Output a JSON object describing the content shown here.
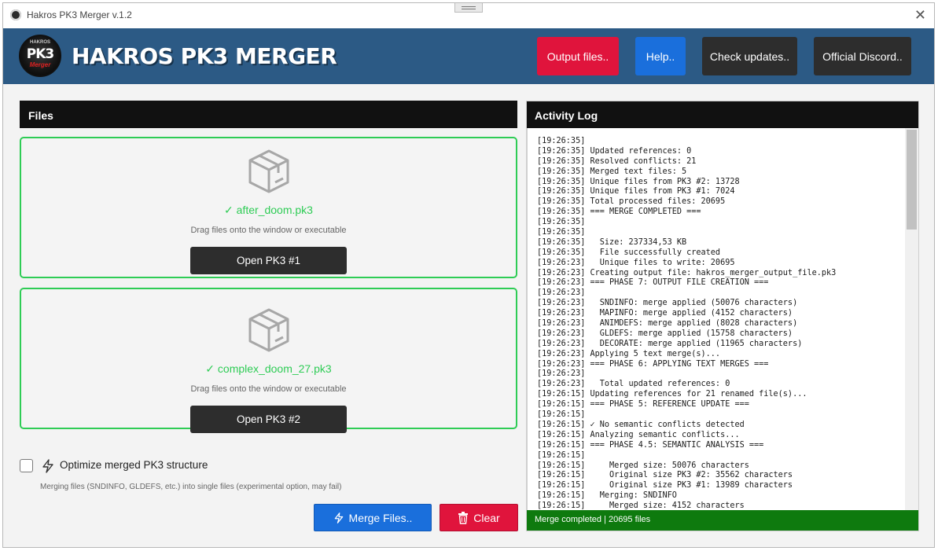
{
  "window": {
    "title": "Hakros PK3 Merger v.1.2",
    "close_glyph": "✕"
  },
  "header": {
    "logo": {
      "top": "HAKROS",
      "main": "PK3",
      "sub": "Merger"
    },
    "brand": "HAKROS PK3 MERGER",
    "buttons": {
      "output": "Output files..",
      "help": "Help..",
      "updates": "Check updates..",
      "discord": "Official Discord.."
    }
  },
  "files_panel": {
    "title": "Files",
    "pk3_1": {
      "filename": "✓ after_doom.pk3",
      "hint": "Drag files onto the window or executable",
      "button": "Open PK3 #1"
    },
    "pk3_2": {
      "filename": "✓ complex_doom_27.pk3",
      "hint": "Drag files onto the window or executable",
      "button": "Open PK3 #2"
    }
  },
  "options": {
    "optimize_checked": false,
    "optimize_label": "Optimize merged PK3 structure",
    "optimize_desc": "Merging files (SNDINFO, GLDEFS, etc.) into single files (experimental option, may fail)"
  },
  "actions": {
    "merge": "Merge Files..",
    "clear": "Clear"
  },
  "log_panel": {
    "title": "Activity Log",
    "lines": [
      "[19:26:35]",
      "[19:26:35] Updated references: 0",
      "[19:26:35] Resolved conflicts: 21",
      "[19:26:35] Merged text files: 5",
      "[19:26:35] Unique files from PK3 #2: 13728",
      "[19:26:35] Unique files from PK3 #1: 7024",
      "[19:26:35] Total processed files: 20695",
      "[19:26:35] === MERGE COMPLETED ===",
      "[19:26:35]",
      "[19:26:35]",
      "[19:26:35]   Size: 237334,53 KB",
      "[19:26:35]   File successfully created",
      "[19:26:23]   Unique files to write: 20695",
      "[19:26:23] Creating output file: hakros_merger_output_file.pk3",
      "[19:26:23] === PHASE 7: OUTPUT FILE CREATION ===",
      "[19:26:23]",
      "[19:26:23]   SNDINFO: merge applied (50076 characters)",
      "[19:26:23]   MAPINFO: merge applied (4152 characters)",
      "[19:26:23]   ANIMDEFS: merge applied (8028 characters)",
      "[19:26:23]   GLDEFS: merge applied (15758 characters)",
      "[19:26:23]   DECORATE: merge applied (11965 characters)",
      "[19:26:23] Applying 5 text merge(s)...",
      "[19:26:23] === PHASE 6: APPLYING TEXT MERGES ===",
      "[19:26:23]",
      "[19:26:23]   Total updated references: 0",
      "[19:26:15] Updating references for 21 renamed file(s)...",
      "[19:26:15] === PHASE 5: REFERENCE UPDATE ===",
      "[19:26:15]",
      "[19:26:15] ✓ No semantic conflicts detected",
      "[19:26:15] Analyzing semantic conflicts...",
      "[19:26:15] === PHASE 4.5: SEMANTIC ANALYSIS ===",
      "[19:26:15]",
      "[19:26:15]     Merged size: 50076 characters",
      "[19:26:15]     Original size PK3 #2: 35562 characters",
      "[19:26:15]     Original size PK3 #1: 13989 characters",
      "[19:26:15]   Merging: SNDINFO",
      "[19:26:15]     Merged size: 4152 characters"
    ],
    "status": "Merge completed | 20695 files"
  },
  "colors": {
    "header_bg": "#2c5a85",
    "accent_red": "#e0143c",
    "accent_blue": "#1a6fdc",
    "success_green": "#2ecc55",
    "status_green": "#0e7a0e"
  },
  "icons": {
    "box": "package-icon",
    "bolt": "lightning-icon",
    "trash": "trash-icon",
    "close": "close-icon"
  }
}
